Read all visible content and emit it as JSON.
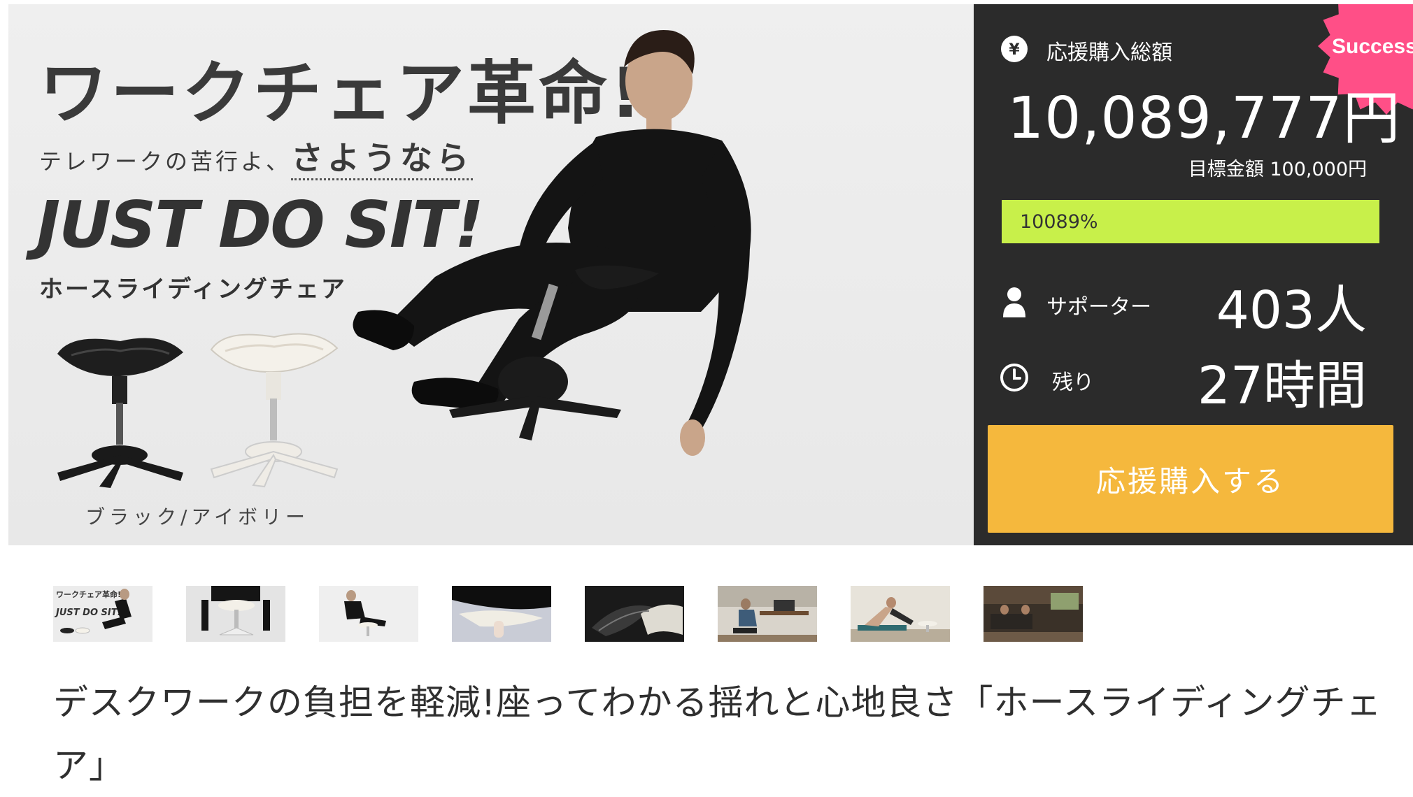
{
  "hero": {
    "title": "ワークチェア革命!",
    "subtitle_plain": "テレワークの苦行よ、",
    "subtitle_emphasis": "さようなら",
    "slogan": "JUST DO SIT!",
    "product_name": "ホースライディングチェア",
    "color_options": "ブラック/アイボリー"
  },
  "stats": {
    "badge": "Success!",
    "badge_color": "#ff4f87",
    "total_label": "応援購入総額",
    "total_amount": "10,089,777円",
    "goal_label": "目標金額",
    "goal_amount": "100,000円",
    "progress_text": "10089%",
    "progress_fraction": 1.0,
    "progress_color": "#c8f04a",
    "supporters_label": "サポーター",
    "supporters_value": "403人",
    "remaining_label": "残り",
    "remaining_value": "27時間",
    "icons": [
      "yen-icon",
      "user-icon",
      "clock-icon"
    ]
  },
  "cta": {
    "label": "応援購入する",
    "color": "#f5b83d"
  },
  "gallery": {
    "thumbnails": [
      {
        "name": "thumbnail-hero",
        "caption": "ワークチェア革命!",
        "caption2": "JUST DO SIT!"
      },
      {
        "name": "thumbnail-sitting-side"
      },
      {
        "name": "thumbnail-reclining"
      },
      {
        "name": "thumbnail-seat-closeup"
      },
      {
        "name": "thumbnail-seat-dark"
      },
      {
        "name": "thumbnail-office-desk"
      },
      {
        "name": "thumbnail-yoga-stretch"
      },
      {
        "name": "thumbnail-living-room"
      }
    ]
  },
  "project": {
    "title": "デスクワークの負担を軽減!座ってわかる揺れと心地良さ「ホースライディングチェア」"
  }
}
